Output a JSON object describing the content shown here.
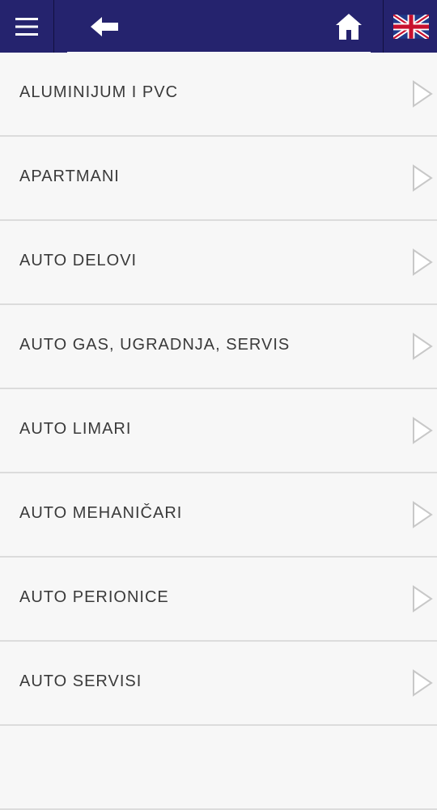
{
  "header": {
    "menu_icon": "hamburger-menu-icon",
    "back_icon": "arrow-left-icon",
    "home_icon": "home-icon",
    "language_icon": "uk-flag-icon"
  },
  "categories": [
    {
      "label": "ALUMINIJUM I PVC"
    },
    {
      "label": "APARTMANI"
    },
    {
      "label": "AUTO DELOVI"
    },
    {
      "label": "AUTO GAS, UGRADNJA, SERVIS"
    },
    {
      "label": "AUTO LIMARI"
    },
    {
      "label": "AUTO MEHANIČARI"
    },
    {
      "label": "AUTO PERIONICE"
    },
    {
      "label": "AUTO SERVISI"
    },
    {
      "label": ""
    }
  ],
  "colors": {
    "header_bg": "#25236e",
    "list_bg": "#f7f7f7",
    "divider": "#dcdcdc",
    "text": "#3a3a3a",
    "chevron": "#c8c8c8"
  }
}
